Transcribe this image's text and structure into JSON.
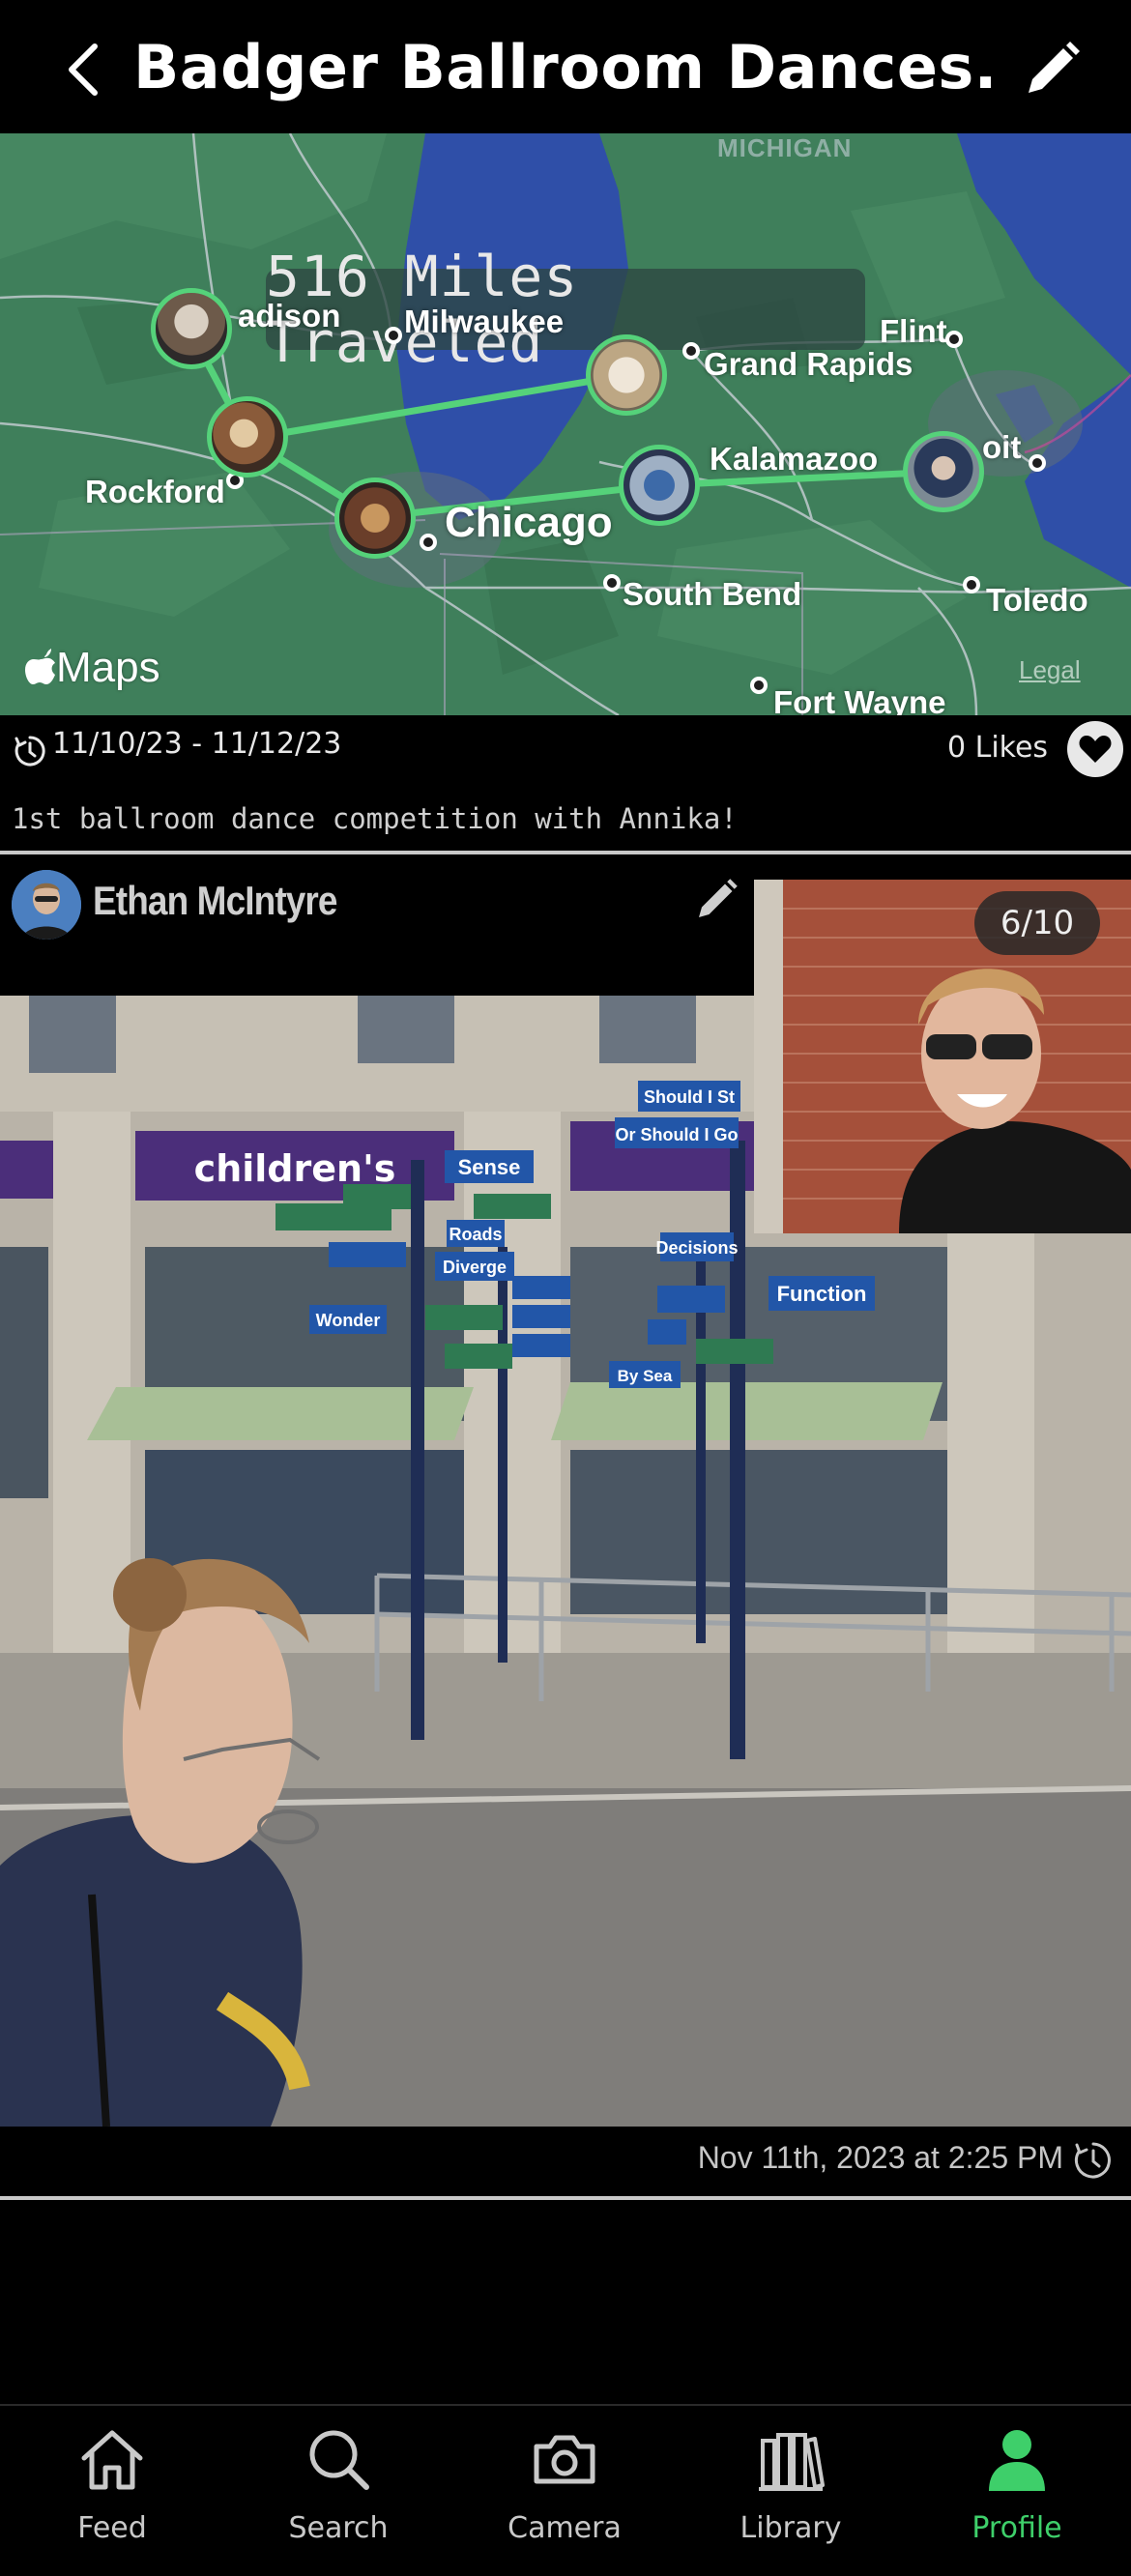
{
  "header": {
    "title": "Badger Ballroom Dances...",
    "back_icon": "chevron-left-icon",
    "edit_icon": "pencil-icon"
  },
  "map": {
    "miles_label": "516 Miles Traveled",
    "region_label": "MICHIGAN",
    "cities": {
      "madison": "adison",
      "milwaukee": "Milwaukee",
      "flint": "Flint",
      "grand_rapids": "Grand Rapids",
      "rockford": "Rockford",
      "kalamazoo": "Kalamazoo",
      "detroit": "oit",
      "chicago": "Chicago",
      "south_bend": "South Bend",
      "toledo": "Toledo",
      "fort_wayne": "Fort Wayne"
    },
    "attribution": "Maps",
    "legal": "Legal",
    "route_color": "#55d27a",
    "water_color": "#2f4fa8",
    "land_color": "#3f7f5b"
  },
  "trip": {
    "dates": "11/10/23 - 11/12/23",
    "likes": "0 Likes",
    "description": "1st ballroom dance competition with Annika!"
  },
  "post": {
    "author": "Ethan McIntyre",
    "counter": "6/10",
    "timestamp": "Nov 11th, 2023 at 2:25 PM",
    "storefront_sign": "children's",
    "street_signs": [
      "Sense",
      "Function",
      "Decisions",
      "Diverge",
      "Roads",
      "Wonder",
      "By Sea",
      "Or Should I Go",
      "Should I St"
    ]
  },
  "tabbar": {
    "items": [
      {
        "label": "Feed",
        "icon": "house-icon"
      },
      {
        "label": "Search",
        "icon": "magnifier-icon"
      },
      {
        "label": "Camera",
        "icon": "camera-icon"
      },
      {
        "label": "Library",
        "icon": "books-icon"
      },
      {
        "label": "Profile",
        "icon": "person-icon"
      }
    ],
    "active": "Profile",
    "accent": "#3ecf6a"
  }
}
